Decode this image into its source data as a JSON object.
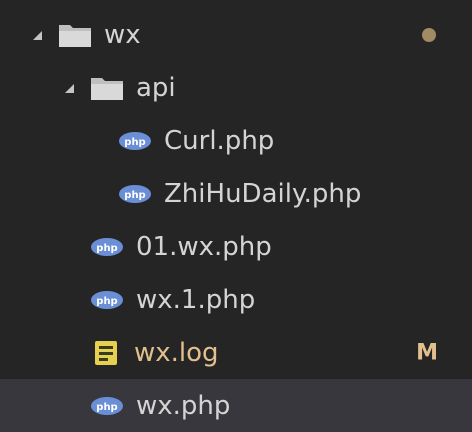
{
  "explorer": {
    "items": [
      {
        "label": "wx",
        "kind": "folder",
        "expanded": true,
        "badge": "dot"
      },
      {
        "label": "api",
        "kind": "folder",
        "expanded": true
      },
      {
        "label": "Curl.php",
        "kind": "php"
      },
      {
        "label": "ZhiHuDaily.php",
        "kind": "php"
      },
      {
        "label": "01.wx.php",
        "kind": "php"
      },
      {
        "label": "wx.1.php",
        "kind": "php"
      },
      {
        "label": "wx.log",
        "kind": "log",
        "status": "M"
      },
      {
        "label": "wx.php",
        "kind": "php",
        "selected": true
      }
    ]
  },
  "colors": {
    "background": "#252526",
    "selected_row": "#37373d",
    "text": "#d4d4d4",
    "modified": "#e2c08d",
    "php_icon": "#6b8fd6",
    "folder_icon": "#c9c9c9",
    "log_icon": "#e6d04f"
  }
}
